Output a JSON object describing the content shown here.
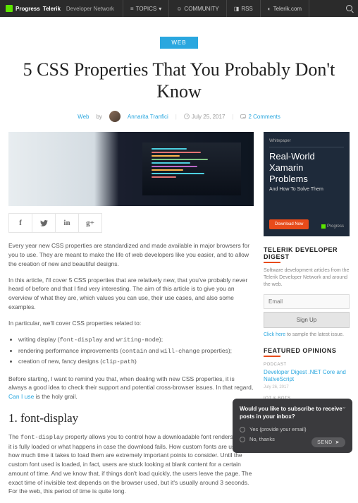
{
  "topbar": {
    "brand_main": "Progress",
    "brand_sub": "Telerik",
    "brand_dnet": "Developer Network",
    "nav": {
      "topics": "TOPICS",
      "community": "COMMUNITY",
      "rss": "RSS",
      "telerik": "Telerik.com"
    }
  },
  "post": {
    "category_badge": "WEB",
    "title": "5 CSS Properties That You Probably Don't Know",
    "meta": {
      "category": "Web",
      "by": "by",
      "author": "Annarita Tranfici",
      "date": "July 25, 2017",
      "comments": "2 Comments"
    }
  },
  "social": {
    "facebook": "f",
    "twitter": "t",
    "linkedin": "in",
    "google": "g+"
  },
  "article": {
    "p1": "Every year new CSS properties are standardized and made available in major browsers for you to use. They are meant to make the life of web developers like you easier, and to allow the creation of new and beautiful designs.",
    "p2": "In this article, I'll cover 5 CSS properties that are relatively new, that you've probably never heard of before and that I find very interesting. The aim of this article is to give you an overview of what they are, which values you can use, their use cases, and also some examples.",
    "p3": "In particular, we'll cover CSS properties related to:",
    "li1a": "writing display (",
    "li1b": "font-display",
    "li1c": " and ",
    "li1d": "writing-mode",
    "li1e": ");",
    "li2a": "rendering performance improvements (",
    "li2b": "contain",
    "li2c": " and ",
    "li2d": "will-change",
    "li2e": " properties);",
    "li3a": "creation of new, fancy designs (",
    "li3b": "clip-path",
    "li3c": ")",
    "p4a": "Before starting, I want to remind you that, when dealing with new CSS properties, it is always a good idea to check their support and potential cross-browser issues. In that regard, ",
    "p4link": "Can I use",
    "p4b": " is the holy grail.",
    "h2_1": "1. font-display",
    "p5a": "The ",
    "p5code": "font-display",
    "p5b": " property allows you to control how a downloadable font renders before it is fully loaded or what happens in case the download fails. How custom fonts are used and how much time it takes to load them are extremely important points to consider. Until the custom font used is loaded, in fact, users are stuck looking at blank content for a certain amount of time. And we know that, if things don't load quickly, the users leave the page. The exact time of invisible text depends on the browser used, but it's usually around 3 seconds. For the web, this period of time is quite long."
  },
  "sidebar": {
    "promo": {
      "whitepaper": "Whitepaper",
      "line1": "Real-World",
      "line2": "Xamarin",
      "line3": "Problems",
      "sub": "And How To Solve Them",
      "download": "Download Now",
      "brand": "Progress"
    },
    "digest": {
      "title": "TELERIK DEVELOPER DIGEST",
      "desc": "Software development articles from the Telerik Developer Network and around the web.",
      "email_placeholder": "Email",
      "signup": "Sign Up",
      "sample_link": "Click here",
      "sample_rest": " to sample the latest issue."
    },
    "featured": {
      "title": "FEATURED OPINIONS",
      "tag1": "PODCAST",
      "link1": "Developer Digest .NET Core and NativeScript",
      "date1": "July 26, 2017",
      "tag2": "IOT & BOTS"
    }
  },
  "popup": {
    "question": "Would you like to subscribe to receive posts in your inbox?",
    "opt1": "Yes (provide your email)",
    "opt2": "No, thanks",
    "send": "SEND"
  }
}
